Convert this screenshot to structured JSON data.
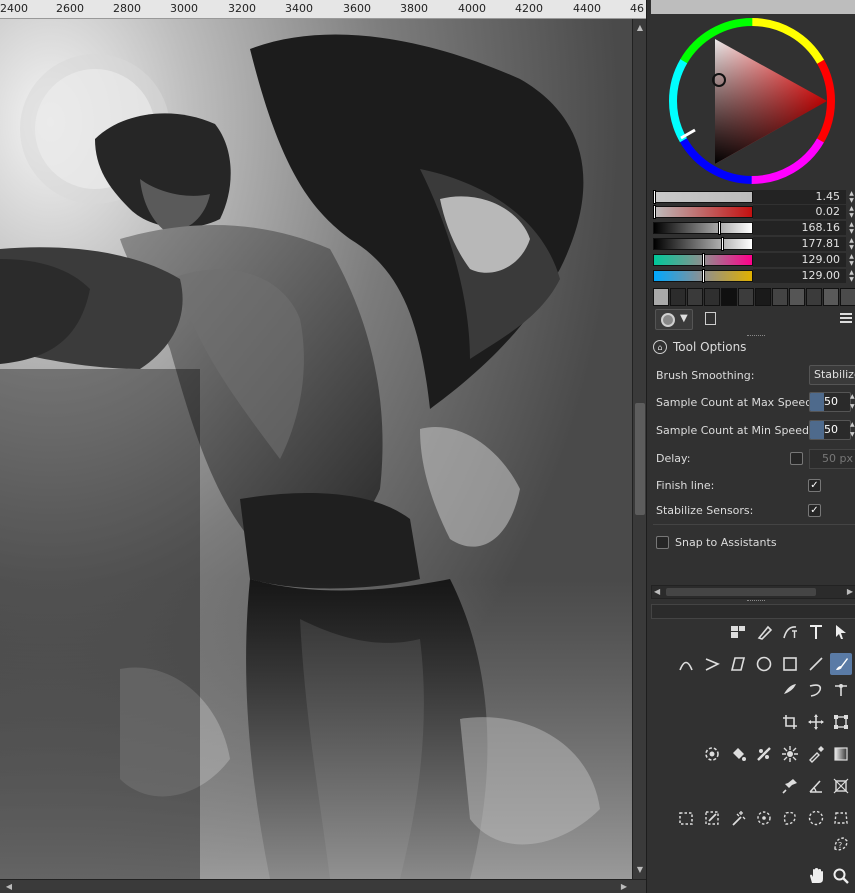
{
  "ruler": {
    "ticks": [
      "2400",
      "2600",
      "2800",
      "3000",
      "3200",
      "3400",
      "3600",
      "3800",
      "4000",
      "4200",
      "4400",
      "46"
    ]
  },
  "canvas": {
    "description_icon": "artwork-canvas"
  },
  "color_panel": {
    "sliders": [
      {
        "name": "hue",
        "value": "1.45",
        "cursor": 0.0
      },
      {
        "name": "saturation",
        "value": "0.02",
        "cursor": 0.0
      },
      {
        "name": "value-1",
        "value": "168.16",
        "cursor": 0.66
      },
      {
        "name": "value-2",
        "value": "177.81",
        "cursor": 0.7
      },
      {
        "name": "channel-a",
        "value": "129.00",
        "cursor": 0.5
      },
      {
        "name": "channel-b",
        "value": "129.00",
        "cursor": 0.5
      }
    ],
    "swatch_colors": [
      "#a9a9a9",
      "#2c2c2c",
      "#3a3a3a",
      "#2f2f2f",
      "#3c3c3c",
      "#101010",
      "#444444",
      "#2a2a2a",
      "#555555",
      "#3b3b3b",
      "#595959",
      "#4b4b4b"
    ]
  },
  "tool_options": {
    "title": "Tool Options",
    "brush_smoothing_label": "Brush Smoothing:",
    "brush_smoothing_value": "Stabilizer",
    "sample_max_label": "Sample Count at Max Speed:",
    "sample_max_value": "50",
    "sample_min_label": "Sample Count at Min Speed:",
    "sample_min_value": "50",
    "delay_label": "Delay:",
    "delay_value": "50 px",
    "finish_line_label": "Finish line:",
    "finish_line_checked": true,
    "stabilize_sensors_label": "Stabilize Sensors:",
    "stabilize_sensors_checked": true,
    "snap_label": "Snap to Assistants",
    "snap_checked": false
  },
  "colors": {
    "accent": "#5a7ba6",
    "panel_bg": "#313131",
    "field_bg": "#232323"
  }
}
